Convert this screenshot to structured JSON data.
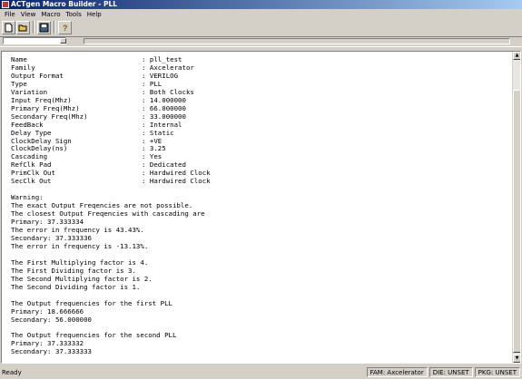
{
  "window": {
    "title": "ACTgen Macro Builder - PLL"
  },
  "menu": [
    "File",
    "View",
    "Macro",
    "Tools",
    "Help"
  ],
  "toolbar": {
    "icons": [
      "new-file-icon",
      "open-folder-icon",
      "save-icon",
      "help-icon"
    ]
  },
  "content": {
    "params": [
      {
        "label": "Name",
        "value": ": pll_test"
      },
      {
        "label": "Family",
        "value": ": Axcelerator"
      },
      {
        "label": "Output Format",
        "value": ": VERILOG"
      },
      {
        "label": "Type",
        "value": ": PLL"
      },
      {
        "label": "Variation",
        "value": ": Both Clocks"
      },
      {
        "label": "Input Freq(Mhz)",
        "value": ": 14.000000"
      },
      {
        "label": "Primary Freq(Mhz)",
        "value": ": 66.000000"
      },
      {
        "label": "Secondary Freq(Mhz)",
        "value": ": 33.000000"
      },
      {
        "label": "FeedBack",
        "value": ": Internal"
      },
      {
        "label": "Delay Type",
        "value": ": Static"
      },
      {
        "label": "ClockDelay Sign",
        "value": ": +VE"
      },
      {
        "label": "ClockDelay(ns)",
        "value": ": 3.25"
      },
      {
        "label": "Cascading",
        "value": ": Yes"
      },
      {
        "label": "RefClk Pad",
        "value": ": Dedicated"
      },
      {
        "label": "PrimClk Out",
        "value": ": Hardwired Clock"
      },
      {
        "label": "SecClk Out",
        "value": ": Hardwired Clock"
      }
    ],
    "lines": [
      "",
      "Warning:",
      "The exact Output Freqencies are not possible.",
      "The closest Output Freqencies with cascading are",
      "Primary: 37.333334",
      "The error in frequency is 43.43%.",
      "Secondary: 37.333336",
      "The error in frequency is -13.13%.",
      "",
      "The First Multiplying factor is 4.",
      "The First Dividing factor is 3.",
      "The Second Multiplying factor is 2.",
      "The Second Dividing factor is 1.",
      "",
      "The Output frequencies for the first PLL",
      "Primary: 18.666666",
      "Secondary: 56.000000",
      "",
      "The Output frequencies for the second PLL",
      "Primary: 37.333332",
      "Secondary: 37.333333"
    ]
  },
  "status": {
    "main": "Ready",
    "fam": "FAM: Axcelerator",
    "die": "DIE: UNSET",
    "pkg": "PKG: UNSET"
  }
}
